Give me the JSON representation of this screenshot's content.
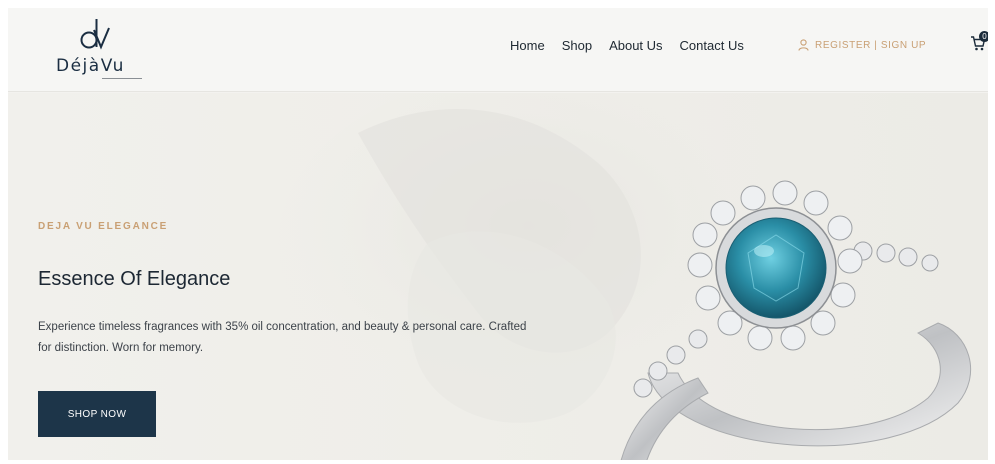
{
  "brand": {
    "name": "DéjàVu",
    "mark": "dv"
  },
  "nav": {
    "items": [
      {
        "label": "Home"
      },
      {
        "label": "Shop"
      },
      {
        "label": "About Us"
      },
      {
        "label": "Contact Us"
      }
    ]
  },
  "auth": {
    "label": "REGISTER | SIGN UP"
  },
  "cart": {
    "count": "0"
  },
  "hero": {
    "eyebrow": "DEJA VU ELEGANCE",
    "title": "Essence Of Elegance",
    "description": "Experience timeless fragrances with 35% oil concentration, and beauty & personal care. Crafted for distinction. Worn for memory.",
    "cta": "SHOP NOW"
  },
  "colors": {
    "accent": "#c9a074",
    "navy": "#1d3549",
    "gem": "#2a8ea6"
  },
  "icons": {
    "user": "user-icon",
    "cart": "cart-icon"
  }
}
